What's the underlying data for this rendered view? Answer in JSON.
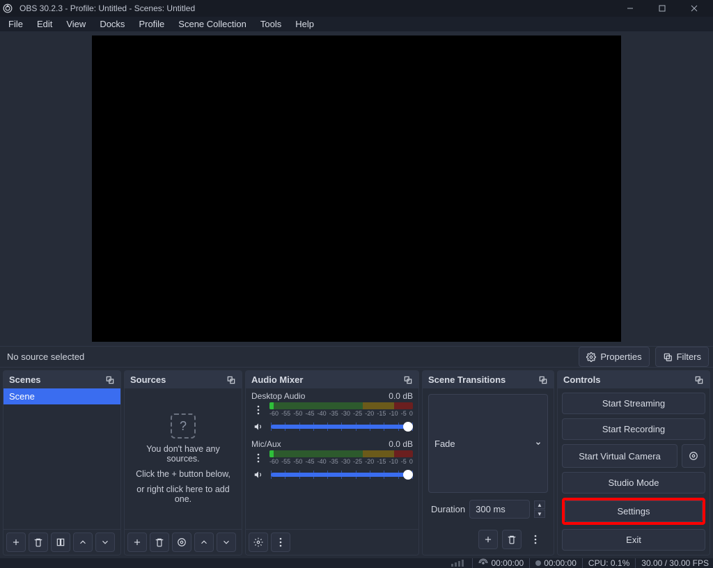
{
  "title": "OBS 30.2.3 - Profile: Untitled - Scenes: Untitled",
  "menu": [
    "File",
    "Edit",
    "View",
    "Docks",
    "Profile",
    "Scene Collection",
    "Tools",
    "Help"
  ],
  "subtoolbar": {
    "no_source": "No source selected",
    "properties": "Properties",
    "filters": "Filters"
  },
  "scenes": {
    "header": "Scenes",
    "items": [
      {
        "label": "Scene"
      }
    ]
  },
  "sources": {
    "header": "Sources",
    "empty1": "You don't have any sources.",
    "empty2": "Click the + button below,",
    "empty3": "or right click here to add one."
  },
  "audio": {
    "header": "Audio Mixer",
    "scale": [
      "-60",
      "-55",
      "-50",
      "-45",
      "-40",
      "-35",
      "-30",
      "-25",
      "-20",
      "-15",
      "-10",
      "-5",
      "0"
    ],
    "channels": [
      {
        "name": "Desktop Audio",
        "db": "0.0 dB"
      },
      {
        "name": "Mic/Aux",
        "db": "0.0 dB"
      }
    ]
  },
  "transitions": {
    "header": "Scene Transitions",
    "selected": "Fade",
    "duration_label": "Duration",
    "duration_value": "300 ms"
  },
  "controls": {
    "header": "Controls",
    "start_streaming": "Start Streaming",
    "start_recording": "Start Recording",
    "start_vcam": "Start Virtual Camera",
    "studio_mode": "Studio Mode",
    "settings": "Settings",
    "exit": "Exit"
  },
  "status": {
    "live_time": "00:00:00",
    "rec_time": "00:00:00",
    "cpu": "CPU: 0.1%",
    "fps": "30.00 / 30.00 FPS"
  },
  "highlighted_control": "settings"
}
